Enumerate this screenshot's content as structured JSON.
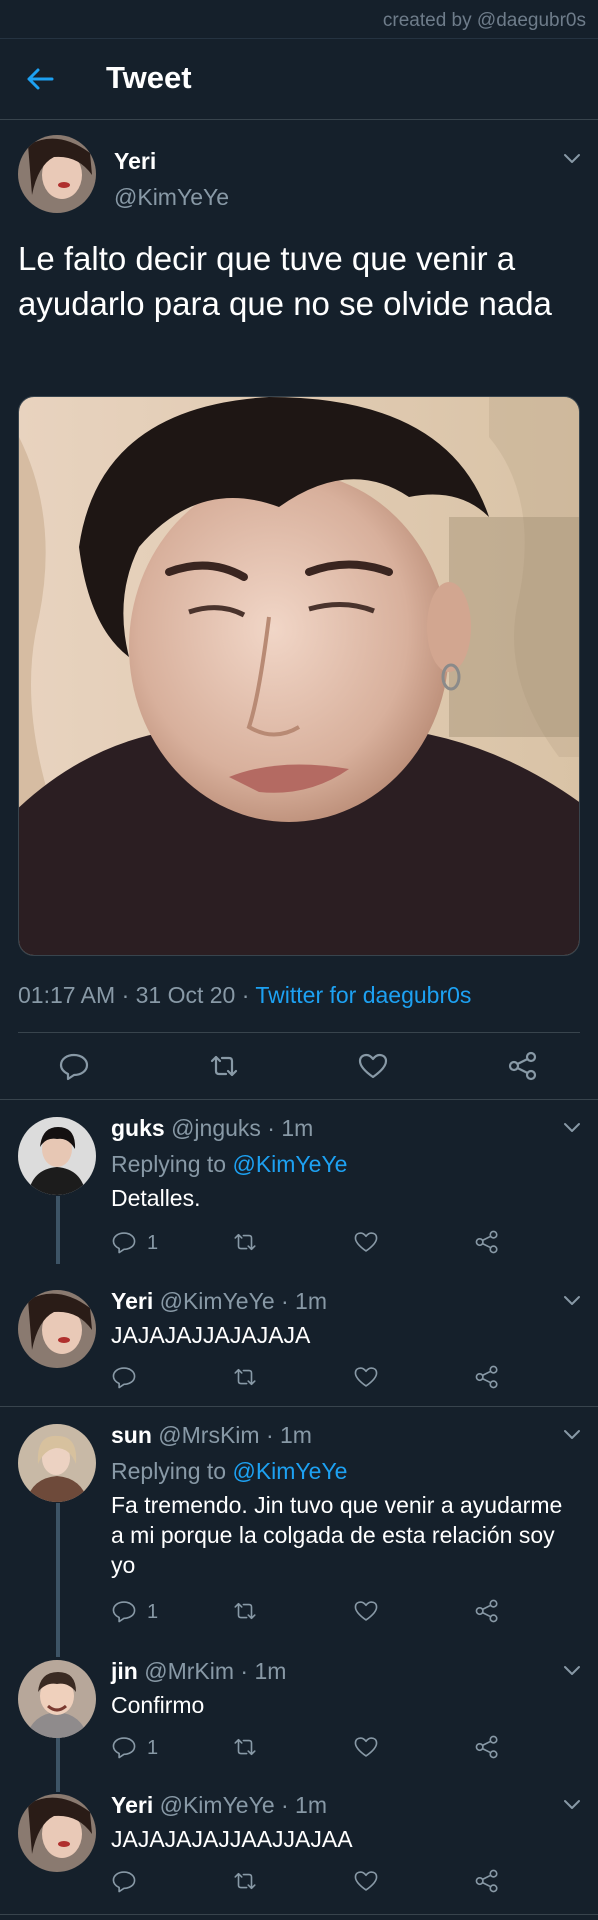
{
  "credit": "created by @daegubr0s",
  "appbar": {
    "title": "Tweet"
  },
  "main_tweet": {
    "name": "Yeri",
    "handle": "@KimYeYe",
    "text": "Le falto decir que tuve que venir a ayudarlo para que no se olvide nada",
    "time": "01:17 AM · 31 Oct 20 · ",
    "source": "Twitter for daegubr0s"
  },
  "replies": [
    {
      "name": "guks",
      "meta": "@jnguks · 1m",
      "replying_label": "Replying to ",
      "replying_to": "@KimYeYe",
      "text": "Detalles.",
      "reply_count": "1"
    },
    {
      "name": "Yeri",
      "meta": "@KimYeYe · 1m",
      "text": "JAJAJAJJAJAJAJA"
    },
    {
      "name": "sun",
      "meta": "@MrsKim · 1m",
      "replying_label": "Replying to ",
      "replying_to": "@KimYeYe",
      "text": "Fa tremendo. Jin tuvo que venir a ayudarme a mi porque la colgada de esta relación soy yo",
      "reply_count": "1"
    },
    {
      "name": "jin",
      "meta": "@MrKim · 1m",
      "text": "Confirmo",
      "reply_count": "1"
    },
    {
      "name": "Yeri",
      "meta": "@KimYeYe · 1m",
      "text": "JAJAJAJAJJAAJJAJAA"
    }
  ],
  "colors": {
    "background": "#15202b",
    "accent": "#1da1f2",
    "muted": "#8899a6",
    "divider": "#38444d"
  },
  "icons": [
    "back-arrow-icon",
    "chevron-down-icon",
    "reply-icon",
    "retweet-icon",
    "like-icon",
    "share-icon"
  ]
}
